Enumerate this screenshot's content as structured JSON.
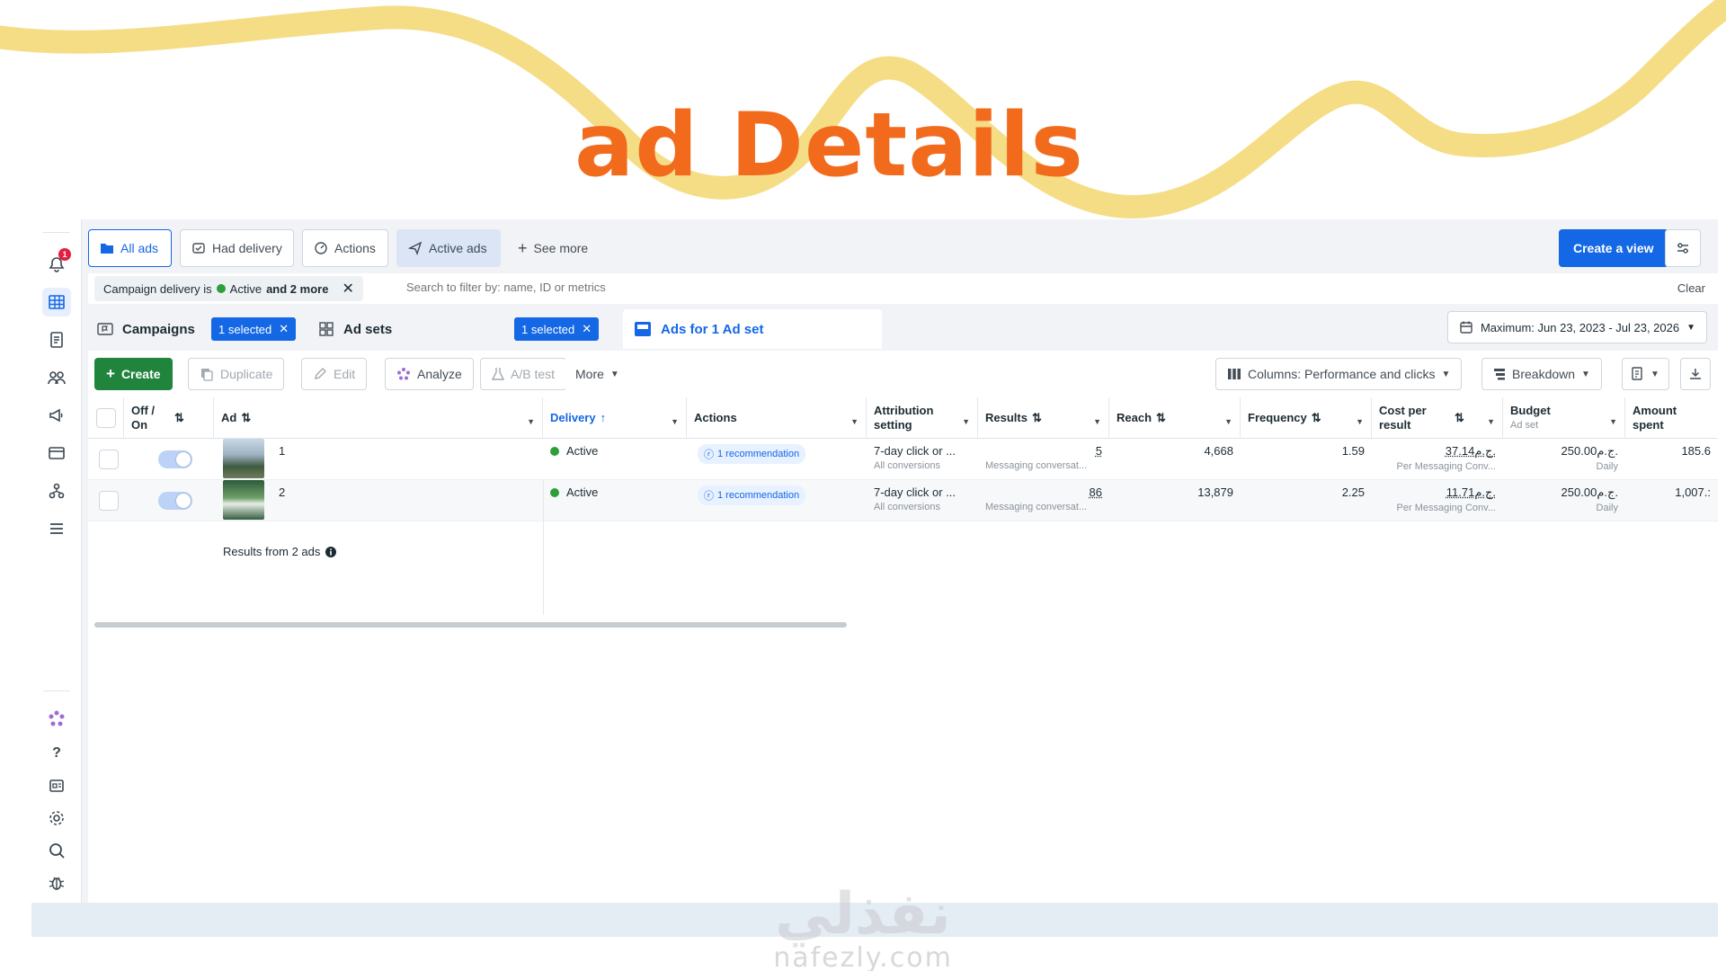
{
  "headline": "ad Details",
  "colors": {
    "accent": "#1467e5",
    "headline": "#f26b1d",
    "create": "#21843d",
    "active": "#2e9e3b",
    "swoosh": "#f5dd86"
  },
  "rail": {
    "notifications_badge": "1"
  },
  "view_tabs": {
    "all_ads": "All ads",
    "had_delivery": "Had delivery",
    "actions": "Actions",
    "active_ads": "Active ads",
    "see_more": "See more",
    "create_view": "Create a view"
  },
  "filter": {
    "chip_prefix": "Campaign delivery is",
    "chip_value": "Active",
    "chip_suffix": "and 2 more",
    "placeholder": "Search to filter by: name, ID or metrics",
    "clear": "Clear"
  },
  "levels": {
    "campaigns": "Campaigns",
    "campaigns_selected": "1 selected",
    "ad_sets": "Ad sets",
    "ad_sets_selected": "1 selected",
    "ads_for": "Ads for 1 Ad set",
    "date_range": "Maximum: Jun 23, 2023 - Jul 23, 2026"
  },
  "toolbar": {
    "create": "Create",
    "duplicate": "Duplicate",
    "edit": "Edit",
    "analyze": "Analyze",
    "ab_test": "A/B test",
    "more": "More",
    "columns": "Columns: Performance and clicks",
    "breakdown": "Breakdown"
  },
  "columns": {
    "off_on": "Off / On",
    "ad": "Ad",
    "delivery": "Delivery",
    "actions": "Actions",
    "attribution": "Attribution setting",
    "results": "Results",
    "reach": "Reach",
    "frequency": "Frequency",
    "cost_per_result": "Cost per result",
    "budget": "Budget",
    "budget_sub": "Ad set",
    "amount_spent": "Amount spent"
  },
  "rows": [
    {
      "name": "1",
      "delivery": "Active",
      "recommendation": "1 recommendation",
      "attribution": "7-day click or ...",
      "attribution_sub": "All conversions",
      "results": "5",
      "results_sub": "Messaging conversat...",
      "reach": "4,668",
      "frequency": "1.59",
      "cost": "37.14ج.م.",
      "cost_sub": "Per Messaging Conv...",
      "budget": "250.00ج.م.",
      "budget_sub": "Daily",
      "spent": "185.6"
    },
    {
      "name": "2",
      "delivery": "Active",
      "recommendation": "1 recommendation",
      "attribution": "7-day click or ...",
      "attribution_sub": "All conversions",
      "results": "86",
      "results_sub": "Messaging conversat...",
      "reach": "13,879",
      "frequency": "2.25",
      "cost": "11.71ج.م.",
      "cost_sub": "Per Messaging Conv...",
      "budget": "250.00ج.م.",
      "budget_sub": "Daily",
      "spent": "1,007.:"
    }
  ],
  "summary": "Results from 2 ads",
  "watermark": {
    "arabic": "نفذلي",
    "latin": "nafezly.com"
  }
}
